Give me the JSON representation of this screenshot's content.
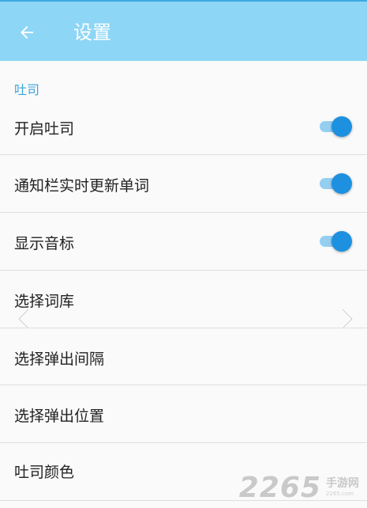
{
  "header": {
    "title": "设置",
    "back_icon": "arrow-left-icon"
  },
  "section": {
    "title": "吐司"
  },
  "settings": [
    {
      "label": "开启吐司",
      "toggle": true
    },
    {
      "label": "通知栏实时更新单词",
      "toggle": true
    },
    {
      "label": "显示音标",
      "toggle": true
    },
    {
      "label": "选择词库",
      "toggle": null
    },
    {
      "label": "选择弹出间隔",
      "toggle": null
    },
    {
      "label": "选择弹出位置",
      "toggle": null
    },
    {
      "label": "吐司颜色",
      "toggle": null
    }
  ],
  "nav": {
    "prev_icon": "chevron-left-icon",
    "next_icon": "chevron-right-icon"
  },
  "watermark": {
    "number": "2265",
    "text": "手游网",
    "sub": "2265.com"
  },
  "colors": {
    "accent": "#8dd6f6",
    "switch_on": "#1e90e0",
    "section": "#3ba3d8"
  }
}
